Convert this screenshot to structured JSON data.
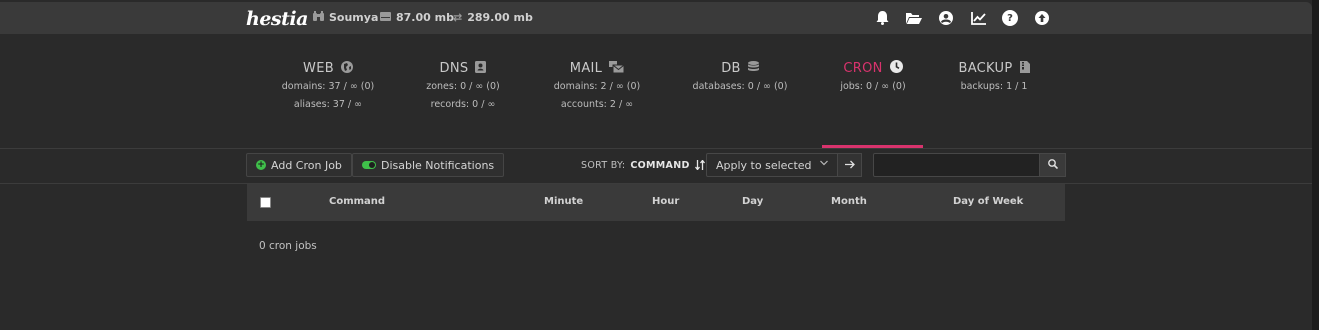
{
  "topbar": {
    "logo": "hestia",
    "user": "Soumya",
    "disk": "87.00 mb",
    "bandwidth": "289.00 mb",
    "icons": [
      "bell-icon",
      "folder-open-icon",
      "user-circle-icon",
      "chart-line-icon",
      "help-icon",
      "arrow-up-circle-icon"
    ]
  },
  "stats": [
    {
      "name": "WEB",
      "icon": "globe-icon",
      "lines": [
        "domains: 37 / ∞ (0)",
        "aliases: 37 / ∞"
      ]
    },
    {
      "name": "DNS",
      "icon": "address-book-icon",
      "lines": [
        "zones: 0 / ∞ (0)",
        "records: 0 / ∞"
      ]
    },
    {
      "name": "MAIL",
      "icon": "mail-bulk-icon",
      "lines": [
        "domains: 2 / ∞ (0)",
        "accounts: 2 / ∞"
      ]
    },
    {
      "name": "DB",
      "icon": "database-icon",
      "lines": [
        "databases: 0 / ∞ (0)"
      ]
    },
    {
      "name": "CRON",
      "icon": "clock-icon",
      "lines": [
        "jobs: 0 / ∞ (0)"
      ],
      "active": true
    },
    {
      "name": "BACKUP",
      "icon": "file-zipper-icon",
      "lines": [
        "backups: 1 / 1"
      ]
    }
  ],
  "toolbar": {
    "add_label": "Add Cron Job",
    "notify_label": "Disable Notifications",
    "sort_prefix": "SORT BY:",
    "sort_field": "COMMAND",
    "bulk_select": "Apply to selected",
    "search_value": ""
  },
  "table": {
    "columns": [
      "Command",
      "Minute",
      "Hour",
      "Day",
      "Month",
      "Day of Week"
    ],
    "empty_text": "0 cron jobs"
  },
  "colors": {
    "accent": "#d8336d",
    "green": "#3fbf4a"
  }
}
